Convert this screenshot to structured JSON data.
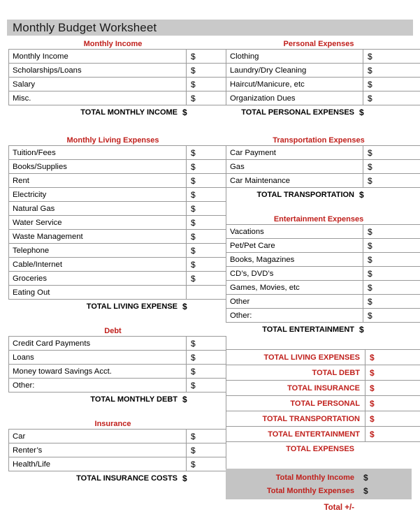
{
  "document": {
    "title": "Monthly Budget Worksheet",
    "currency_symbol": "$",
    "accent_red": "#c0201c",
    "title_band_gray": "#c9c9c9",
    "grand_total_gray": "#c4c4c4"
  },
  "sections": {
    "monthly_income": {
      "heading": "Monthly Income",
      "rows": [
        {
          "label": "Monthly Income",
          "value": "$"
        },
        {
          "label": "Scholarships/Loans",
          "value": "$"
        },
        {
          "label": "Salary",
          "value": "$"
        },
        {
          "label": "Misc.",
          "value": "$"
        }
      ],
      "total_label": "TOTAL MONTHLY INCOME",
      "total_value": "$"
    },
    "personal_expenses": {
      "heading": "Personal Expenses",
      "rows": [
        {
          "label": "Clothing",
          "value": "$"
        },
        {
          "label": "Laundry/Dry Cleaning",
          "value": "$"
        },
        {
          "label": "Haircut/Manicure, etc",
          "value": "$"
        },
        {
          "label": "Organization Dues",
          "value": "$"
        }
      ],
      "total_label": "TOTAL PERSONAL EXPENSES",
      "total_value": "$"
    },
    "monthly_living_expenses": {
      "heading": "Monthly Living Expenses",
      "rows": [
        {
          "label": "Tuition/Fees",
          "value": "$"
        },
        {
          "label": "Books/Supplies",
          "value": "$"
        },
        {
          "label": "Rent",
          "value": "$"
        },
        {
          "label": "Electricity",
          "value": "$"
        },
        {
          "label": "Natural Gas",
          "value": "$"
        },
        {
          "label": "Water Service",
          "value": "$"
        },
        {
          "label": "Waste Management",
          "value": "$"
        },
        {
          "label": "Telephone",
          "value": "$"
        },
        {
          "label": "Cable/Internet",
          "value": "$"
        },
        {
          "label": "Groceries",
          "value": "$"
        },
        {
          "label": "Eating Out",
          "value": ""
        }
      ],
      "total_label": "TOTAL LIVING EXPENSE",
      "total_value": "$"
    },
    "transportation_expenses": {
      "heading": "Transportation Expenses",
      "rows": [
        {
          "label": "Car Payment",
          "value": "$"
        },
        {
          "label": "Gas",
          "value": "$"
        },
        {
          "label": "Car Maintenance",
          "value": "$"
        }
      ],
      "total_label": "TOTAL TRANSPORTATION",
      "total_value": "$"
    },
    "entertainment_expenses": {
      "heading": "Entertainment Expenses",
      "rows": [
        {
          "label": "Vacations",
          "value": "$"
        },
        {
          "label": "Pet/Pet Care",
          "value": "$"
        },
        {
          "label": "Books, Magazines",
          "value": "$"
        },
        {
          "label": "CD’s, DVD’s",
          "value": "$"
        },
        {
          "label": "Games, Movies, etc",
          "value": "$"
        },
        {
          "label": "Other",
          "value": "$"
        },
        {
          "label": "Other:",
          "value": "$"
        }
      ],
      "total_label": "TOTAL ENTERTAINMENT",
      "total_value": "$"
    },
    "debt": {
      "heading": "Debt",
      "rows": [
        {
          "label": "Credit Card Payments",
          "value": "$"
        },
        {
          "label": "Loans",
          "value": "$"
        },
        {
          "label": "Money toward Savings Acct.",
          "value": "$"
        },
        {
          "label": "Other:",
          "value": "$"
        }
      ],
      "total_label": "TOTAL MONTHLY DEBT",
      "total_value": "$"
    },
    "insurance": {
      "heading": "Insurance",
      "rows": [
        {
          "label": "Car",
          "value": "$"
        },
        {
          "label": "Renter’s",
          "value": "$"
        },
        {
          "label": "Health/Life",
          "value": "$"
        }
      ],
      "total_label": "TOTAL INSURANCE COSTS",
      "total_value": "$"
    }
  },
  "summary": {
    "rows": [
      {
        "label": "TOTAL LIVING EXPENSES",
        "value": "$"
      },
      {
        "label": "TOTAL DEBT",
        "value": "$"
      },
      {
        "label": "TOTAL INSURANCE",
        "value": "$"
      },
      {
        "label": "TOTAL PERSONAL",
        "value": "$"
      },
      {
        "label": "TOTAL TRANSPORTATION",
        "value": "$"
      },
      {
        "label": "TOTAL ENTERTAINMENT",
        "value": "$"
      }
    ],
    "footer_label": "TOTAL EXPENSES"
  },
  "grand_total": {
    "rows": [
      {
        "label": "Total Monthly Income",
        "value": "$"
      },
      {
        "label": "Total Monthly Expenses",
        "value": "$"
      }
    ],
    "final_label": "Total +/-"
  }
}
